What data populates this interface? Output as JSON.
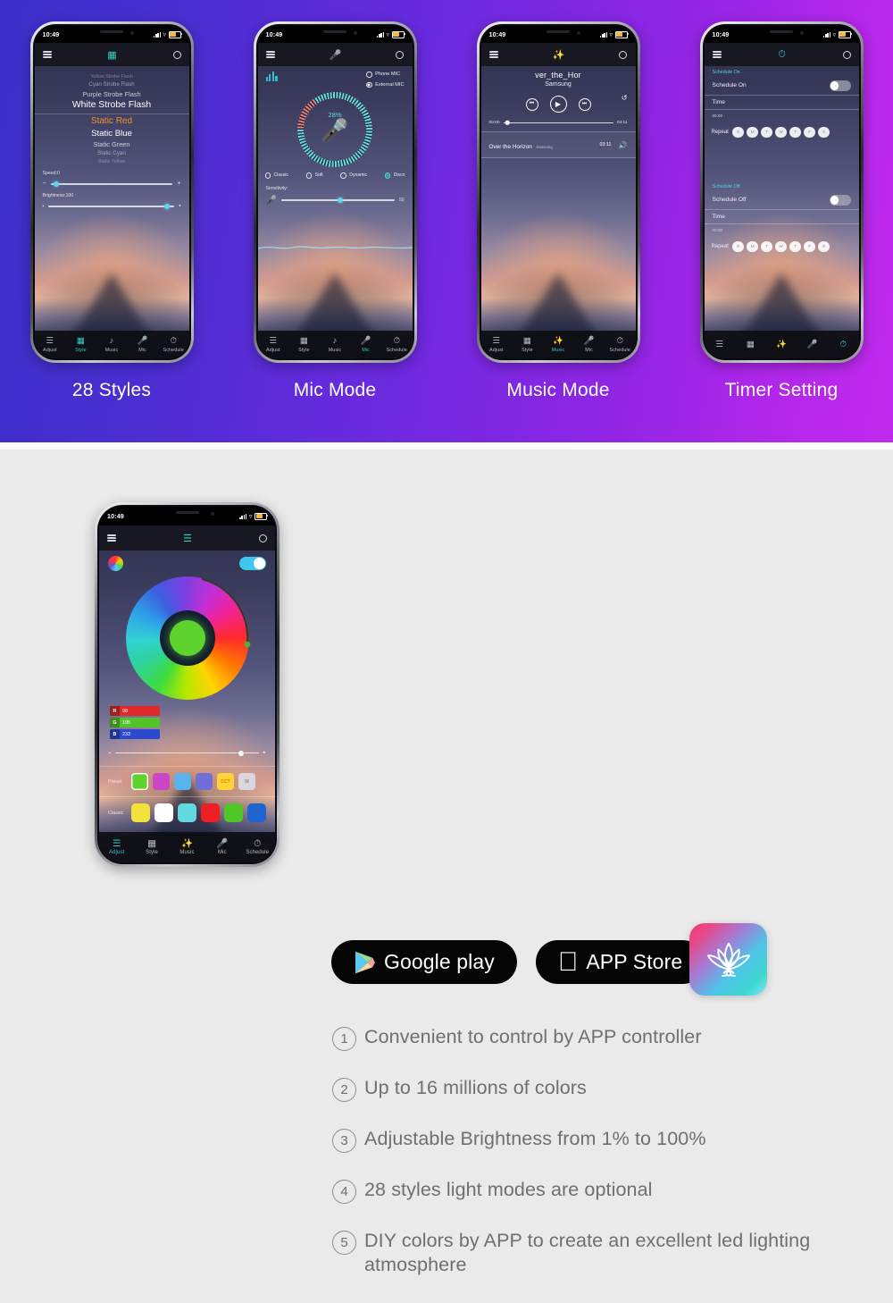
{
  "top": {
    "background_gradient": [
      "#3a2fc8",
      "#c22aee"
    ],
    "captions": [
      "28 Styles",
      "Mic Mode",
      "Music Mode",
      "Timer Setting"
    ],
    "status_bar": {
      "time": "10:49",
      "location_icon": "location-arrow-icon",
      "signal_icon": "cellular-signal-icon",
      "wifi_icon": "wifi-icon",
      "battery_icon": "battery-icon"
    },
    "tabs": [
      {
        "label": "Adjust",
        "icon": "sliders-icon"
      },
      {
        "label": "Style",
        "icon": "grid-icon"
      },
      {
        "label": "Music",
        "icon": "music-note-icon"
      },
      {
        "label": "Mic",
        "icon": "microphone-icon"
      },
      {
        "label": "Schedule",
        "icon": "clock-icon"
      }
    ]
  },
  "phone_styles": {
    "appbar": {
      "menu_icon": "hamburger-menu-icon",
      "center_icon": "grid-icon",
      "settings_icon": "gear-icon"
    },
    "active_tab": "Style",
    "list": [
      {
        "label": "Yellow Strobe Flash",
        "class": "s-f3"
      },
      {
        "label": "Cyan Strobe Flash",
        "class": "s-f2"
      },
      {
        "label": "Purple Strobe Flash",
        "class": "s-f1"
      },
      {
        "label": "White Strobe Flash",
        "class": "s-sel"
      },
      {
        "label": "Static Red",
        "class": "s-red"
      },
      {
        "label": "Static Blue",
        "class": "s-blue"
      },
      {
        "label": "Static Green",
        "class": "s-f1"
      },
      {
        "label": "Static Cyan",
        "class": "s-f2"
      },
      {
        "label": "Static Yellow",
        "class": "s-f3"
      }
    ],
    "speed": {
      "label": "Speed:0",
      "value": 0,
      "minus": "−",
      "plus": "+"
    },
    "brightness": {
      "label": "Brightness:100",
      "value": 100,
      "minus": "▪",
      "plus": "▪"
    }
  },
  "phone_mic": {
    "appbar": {
      "center_icon": "microphone-icon"
    },
    "active_tab": "Mic",
    "eq_icon": "equalizer-icon",
    "source_options": [
      {
        "label": "Phone MIC",
        "selected": false
      },
      {
        "label": "External MIC",
        "selected": true
      }
    ],
    "level_percent": "28%",
    "mic_icon": "microphone-icon",
    "modes": [
      {
        "label": "Classic",
        "selected": false
      },
      {
        "label": "Soft",
        "selected": false
      },
      {
        "label": "Dynamic",
        "selected": false
      },
      {
        "label": "Disco",
        "selected": true
      }
    ],
    "sensitivity": {
      "label": "Sensitivity:",
      "value": "50"
    }
  },
  "phone_music": {
    "appbar": {
      "center_icon": "music-note-icon"
    },
    "active_tab": "Music",
    "now_playing": {
      "title": "ver_the_Hor",
      "artist": "Samsung"
    },
    "loop_icon": "repeat-icon",
    "controls": {
      "prev": "⏮",
      "play": "▶",
      "next": "⏭"
    },
    "progress": {
      "elapsed": "00:00",
      "total": "03:11",
      "percent": 4
    },
    "track": {
      "name": "Over the Horizon",
      "artist": "Samsung",
      "duration": "03:11",
      "action_icon": "speaker-icon"
    }
  },
  "phone_timer": {
    "appbar": {
      "center_icon": "clock-icon"
    },
    "active_tab": "Schedule",
    "schedule_on": {
      "section_header": "Schedule On",
      "toggle_label": "Schedule On",
      "toggle_on": false,
      "time_label": "Time",
      "time_value": "00:00",
      "repeat_label": "Repeat",
      "days": [
        "S",
        "M",
        "T",
        "W",
        "T",
        "F",
        "S"
      ]
    },
    "schedule_off": {
      "section_header": "Schedule Off",
      "toggle_label": "Schedule Off",
      "toggle_on": false,
      "time_label": "Time",
      "time_value": "00:00",
      "repeat_label": "Repeat",
      "days": [
        "S",
        "M",
        "T",
        "W",
        "T",
        "F",
        "S"
      ]
    }
  },
  "phone_adjust": {
    "appbar": {
      "center_icon": "sliders-icon"
    },
    "active_tab": "Adjust",
    "wheel_icon": "color-wheel-icon",
    "power_toggle_on": true,
    "rgb": [
      {
        "key": "R",
        "value": "98",
        "color": "#e02a2a"
      },
      {
        "key": "G",
        "value": "195",
        "color": "#54c32a"
      },
      {
        "key": "B",
        "value": "233",
        "color": "#2a49d0"
      }
    ],
    "brightness_slider": {
      "min_icon": "▪",
      "max_icon": "▪",
      "percent": 88
    },
    "preset": {
      "label": "Preset",
      "swatches": [
        {
          "color": "#5fd32d",
          "text": "",
          "selected": true
        },
        {
          "color": "#cc46c6",
          "text": "",
          "selected": false
        },
        {
          "color": "#59b4ee",
          "text": "",
          "selected": false
        },
        {
          "color": "#6f6fd8",
          "text": "",
          "selected": false
        },
        {
          "color": "#ffd33a",
          "text": "CCT",
          "selected": false
        },
        {
          "color": "#d8d8de",
          "text": "W",
          "selected": false
        }
      ]
    },
    "classic": {
      "label": "Classic",
      "swatches": [
        {
          "color": "#f5e13c"
        },
        {
          "color": "#ffffff"
        },
        {
          "color": "#62d9e0"
        },
        {
          "color": "#ef1f24"
        },
        {
          "color": "#4fc726"
        },
        {
          "color": "#1f64cf"
        }
      ]
    }
  },
  "bottom": {
    "background": "#eaeaea",
    "stores": [
      {
        "label": "Google play",
        "icon": "google-play-icon"
      },
      {
        "label": "APP Store",
        "icon": "apple-logo-icon"
      }
    ],
    "app_icon": {
      "name": "lotus-app-icon",
      "gradient": [
        "#ef3b6e",
        "#4fc3e8"
      ]
    },
    "features": [
      {
        "num": "①",
        "text": "Convenient to control by APP controller"
      },
      {
        "num": "②",
        "text": "Up to 16 millions of colors"
      },
      {
        "num": "③",
        "text": "Adjustable Brightness from 1% to 100%"
      },
      {
        "num": "④",
        "text": "28 styles light modes are optional"
      },
      {
        "num": "⑤",
        "text": "DIY colors by APP to create an excellent led lighting atmosphere"
      }
    ]
  }
}
